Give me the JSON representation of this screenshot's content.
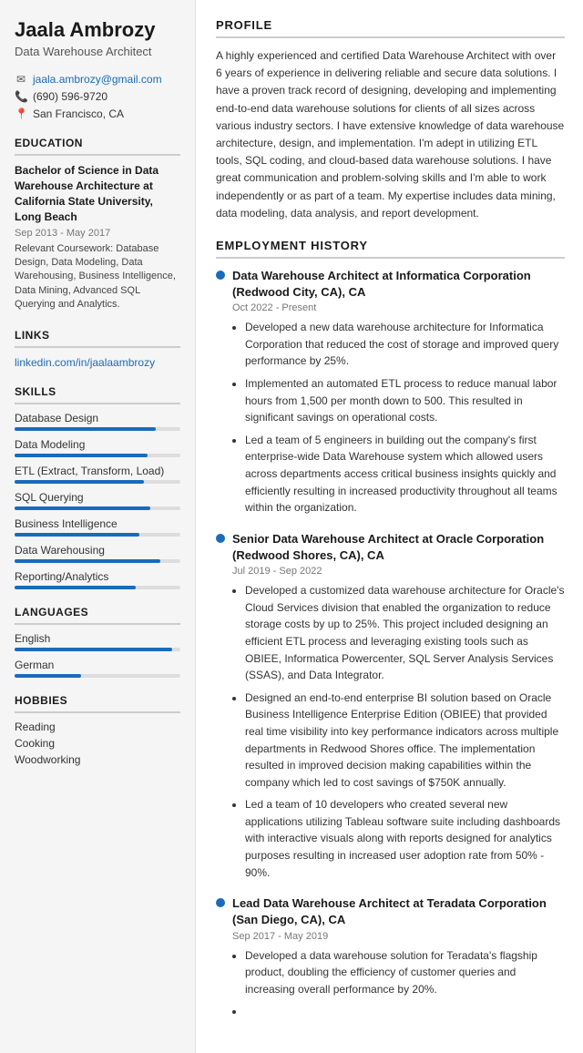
{
  "sidebar": {
    "name": "Jaala Ambrozy",
    "title": "Data Warehouse Architect",
    "contact": {
      "email": "jaala.ambrozy@gmail.com",
      "phone": "(690) 596-9720",
      "location": "San Francisco, CA"
    },
    "education_section": "EDUCATION",
    "education": {
      "degree": "Bachelor of Science in Data Warehouse Architecture at California State University, Long Beach",
      "dates": "Sep 2013 - May 2017",
      "coursework": "Relevant Coursework: Database Design, Data Modeling, Data Warehousing, Business Intelligence, Data Mining, Advanced SQL Querying and Analytics."
    },
    "links_section": "LINKS",
    "links": [
      {
        "text": "linkedin.com/in/jaalaambrozy",
        "url": "#"
      }
    ],
    "skills_section": "SKILLS",
    "skills": [
      {
        "label": "Database Design",
        "pct": 85
      },
      {
        "label": "Data Modeling",
        "pct": 80
      },
      {
        "label": "ETL (Extract, Transform, Load)",
        "pct": 78
      },
      {
        "label": "SQL Querying",
        "pct": 82
      },
      {
        "label": "Business Intelligence",
        "pct": 75
      },
      {
        "label": "Data Warehousing",
        "pct": 88
      },
      {
        "label": "Reporting/Analytics",
        "pct": 73
      }
    ],
    "languages_section": "LANGUAGES",
    "languages": [
      {
        "label": "English",
        "pct": 95
      },
      {
        "label": "German",
        "pct": 40
      }
    ],
    "hobbies_section": "HOBBIES",
    "hobbies": [
      "Reading",
      "Cooking",
      "Woodworking"
    ]
  },
  "main": {
    "profile_section": "PROFILE",
    "profile_text": "A highly experienced and certified Data Warehouse Architect with over 6 years of experience in delivering reliable and secure data solutions. I have a proven track record of designing, developing and implementing end-to-end data warehouse solutions for clients of all sizes across various industry sectors. I have extensive knowledge of data warehouse architecture, design, and implementation. I'm adept in utilizing ETL tools, SQL coding, and cloud-based data warehouse solutions. I have great communication and problem-solving skills and I'm able to work independently or as part of a team. My expertise includes data mining, data modeling, data analysis, and report development.",
    "employment_section": "EMPLOYMENT HISTORY",
    "jobs": [
      {
        "title": "Data Warehouse Architect at Informatica Corporation (Redwood City, CA), CA",
        "dates": "Oct 2022 - Present",
        "bullets": [
          "Developed a new data warehouse architecture for Informatica Corporation that reduced the cost of storage and improved query performance by 25%.",
          "Implemented an automated ETL process to reduce manual labor hours from 1,500 per month down to 500. This resulted in significant savings on operational costs.",
          "Led a team of 5 engineers in building out the company's first enterprise-wide Data Warehouse system which allowed users across departments access critical business insights quickly and efficiently resulting in increased productivity throughout all teams within the organization."
        ]
      },
      {
        "title": "Senior Data Warehouse Architect at Oracle Corporation (Redwood Shores, CA), CA",
        "dates": "Jul 2019 - Sep 2022",
        "bullets": [
          "Developed a customized data warehouse architecture for Oracle's Cloud Services division that enabled the organization to reduce storage costs by up to 25%. This project included designing an efficient ETL process and leveraging existing tools such as OBIEE, Informatica Powercenter, SQL Server Analysis Services (SSAS), and Data Integrator.",
          "Designed an end-to-end enterprise BI solution based on Oracle Business Intelligence Enterprise Edition (OBIEE) that provided real time visibility into key performance indicators across multiple departments in Redwood Shores office. The implementation resulted in improved decision making capabilities within the company which led to cost savings of $750K annually.",
          "Led a team of 10 developers who created several new applications utilizing Tableau software suite including dashboards with interactive visuals along with reports designed for analytics purposes resulting in increased user adoption rate from 50% - 90%."
        ]
      },
      {
        "title": "Lead Data Warehouse Architect at Teradata Corporation (San Diego, CA), CA",
        "dates": "Sep 2017 - May 2019",
        "bullets": [
          "Developed a data warehouse solution for Teradata's flagship product, doubling the efficiency of customer queries and increasing overall performance by 20%.",
          ""
        ]
      }
    ]
  }
}
